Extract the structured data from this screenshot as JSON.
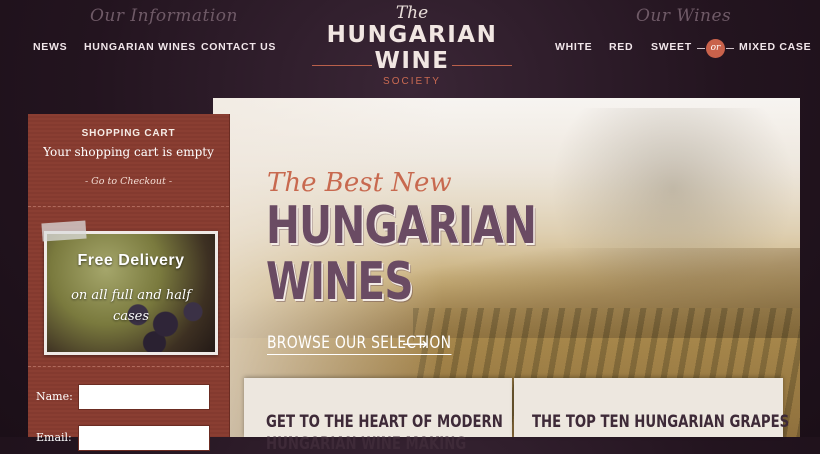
{
  "header": {
    "left_script": "Our Information",
    "right_script": "Our Wines",
    "left_nav": [
      "NEWS",
      "HUNGARIAN WINES",
      "CONTACT US"
    ],
    "right_nav": [
      "WHITE",
      "RED",
      "SWEET",
      "MIXED CASE"
    ],
    "or_label": "or",
    "logo": {
      "the": "The",
      "main": "HUNGARIAN WINE",
      "sub": "SOCIETY"
    }
  },
  "sidebar": {
    "cart_title": "SHOPPING CART",
    "cart_status": "Your shopping cart is empty",
    "checkout": "- Go to Checkout -",
    "promo_title": "Free Delivery",
    "promo_sub": "on all full and half cases",
    "form": {
      "name_label": "Name:",
      "email_label": "Email:"
    }
  },
  "hero": {
    "script": "The Best New",
    "title_line1": "HUNGARIAN",
    "title_line2": "WINES",
    "browse": "BROWSE OUR SELECTION",
    "browse_arrow": "⟶"
  },
  "panels": {
    "left_line1": "GET TO THE HEART OF MODERN",
    "left_line2": "HUNGARIAN WINE MAKING",
    "right_title": "THE TOP TEN HUNGARIAN GRAPES"
  }
}
